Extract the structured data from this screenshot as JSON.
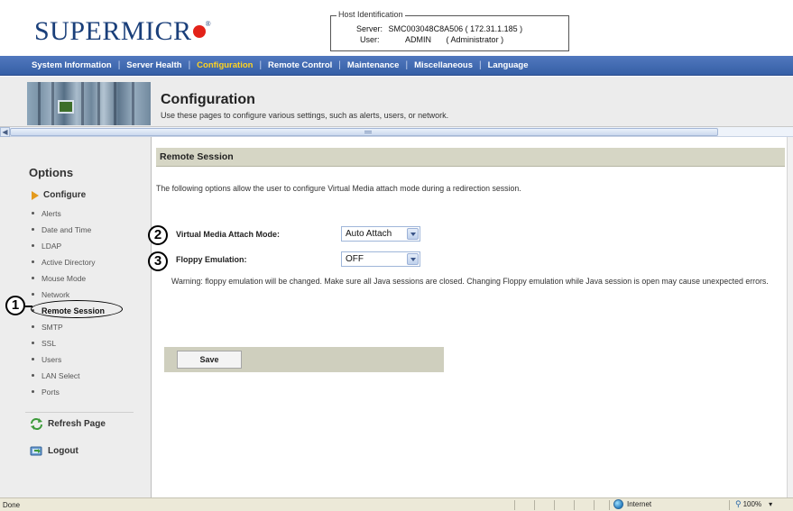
{
  "header": {
    "logo_text": "SUPERMICR",
    "logo_registered": "®",
    "host_identification": {
      "legend": "Host Identification",
      "server_label": "Server:",
      "server_value": "SMC003048C8A506 ( 172.31.1.185 )",
      "user_label": "User:",
      "user_name": "ADMIN",
      "user_role": "( Administrator )"
    }
  },
  "nav": {
    "items": [
      {
        "label": "System Information"
      },
      {
        "label": "Server Health"
      },
      {
        "label": "Configuration"
      },
      {
        "label": "Remote Control"
      },
      {
        "label": "Maintenance"
      },
      {
        "label": "Miscellaneous"
      },
      {
        "label": "Language"
      }
    ],
    "separator": "|",
    "active_index": 2
  },
  "banner": {
    "title": "Configuration",
    "subtitle": "Use these pages to configure various settings, such as alerts, users, or network."
  },
  "sidebar": {
    "options_title": "Options",
    "configure_label": "Configure",
    "items": [
      {
        "label": "Alerts"
      },
      {
        "label": "Date and Time"
      },
      {
        "label": "LDAP"
      },
      {
        "label": "Active Directory"
      },
      {
        "label": "Mouse Mode"
      },
      {
        "label": "Network"
      },
      {
        "label": "Remote Session"
      },
      {
        "label": "SMTP"
      },
      {
        "label": "SSL"
      },
      {
        "label": "Users"
      },
      {
        "label": "LAN Select"
      },
      {
        "label": "Ports"
      }
    ],
    "active_item": "Remote Session",
    "refresh_label": "Refresh Page",
    "logout_label": "Logout"
  },
  "main": {
    "section_title": "Remote Session",
    "description": "The following options allow the user to configure Virtual Media attach mode during a redirection session.",
    "virtual_media": {
      "label": "Virtual Media Attach Mode:",
      "value": "Auto Attach"
    },
    "floppy": {
      "label": "Floppy Emulation:",
      "value": "OFF"
    },
    "warning": "Warning: floppy emulation will be changed. Make sure all Java sessions are closed. Changing Floppy emulation while Java session is open may cause unexpected errors.",
    "save_label": "Save"
  },
  "statusbar": {
    "status": "Done",
    "zone": "Internet",
    "zoom": "100%",
    "zoom_caret": "▾"
  },
  "callouts": [
    "1",
    "2",
    "3"
  ],
  "colors": {
    "nav_active": "#ffd322",
    "nav_bar": "#355fa6",
    "logo_blue": "#1a3f7a",
    "logo_red": "#e32219",
    "configure_arrow": "#e49a1d",
    "section_header": "#d6d6c5"
  },
  "icons": {
    "banner": "server-rack-icon",
    "configure": "arrow-right-icon",
    "refresh": "refresh-icon",
    "logout": "logout-icon",
    "zone": "globe-icon",
    "zoom": "zoom-icon"
  }
}
